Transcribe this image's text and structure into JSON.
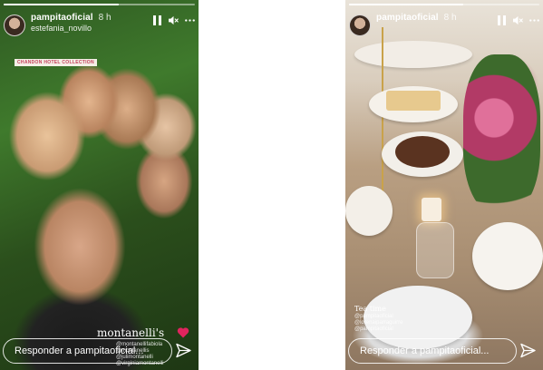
{
  "stories": [
    {
      "username": "pampitaoficial",
      "timestamp": "8 h",
      "subtitle": "estefania_novillo",
      "tag": "CHANDON HOTEL COLLECTION",
      "brand_text": "montanelli's",
      "mentions": [
        "@montanellifabiola",
        "@montanellis",
        "@julimontanelli",
        "@virginiamontanelli"
      ],
      "reply_placeholder": "Responder a pampitaoficial...",
      "progress": 0.6
    },
    {
      "username": "pampitaoficial",
      "timestamp": "8 h",
      "caption": "Tea time",
      "mentions": [
        "@pampitaoficial",
        "@lorenaiparraguirre",
        "@pampitaoficial"
      ],
      "reply_placeholder": "Responder a pampitaoficial...",
      "progress": 0.6
    }
  ],
  "icons": {
    "pause": "pause-icon",
    "mute": "speaker-muted-icon",
    "more": "more-dots-icon",
    "send": "paper-plane-icon",
    "heart": "heart-icon"
  },
  "colors": {
    "heart": "#e0245e",
    "tag_text": "#c4425c"
  }
}
